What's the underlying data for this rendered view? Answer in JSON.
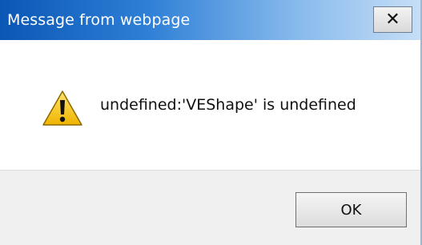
{
  "window": {
    "title": "Message from webpage",
    "close_icon": "close-icon"
  },
  "dialog": {
    "icon": "warning-icon",
    "message": "undefined:'VEShape' is undefined"
  },
  "buttons": {
    "ok_label": "OK"
  },
  "colors": {
    "titlebar_start": "#0a57b5",
    "titlebar_end": "#c6def6",
    "warning_fill": "#f2c200",
    "footer_background": "#f0f0f0"
  }
}
